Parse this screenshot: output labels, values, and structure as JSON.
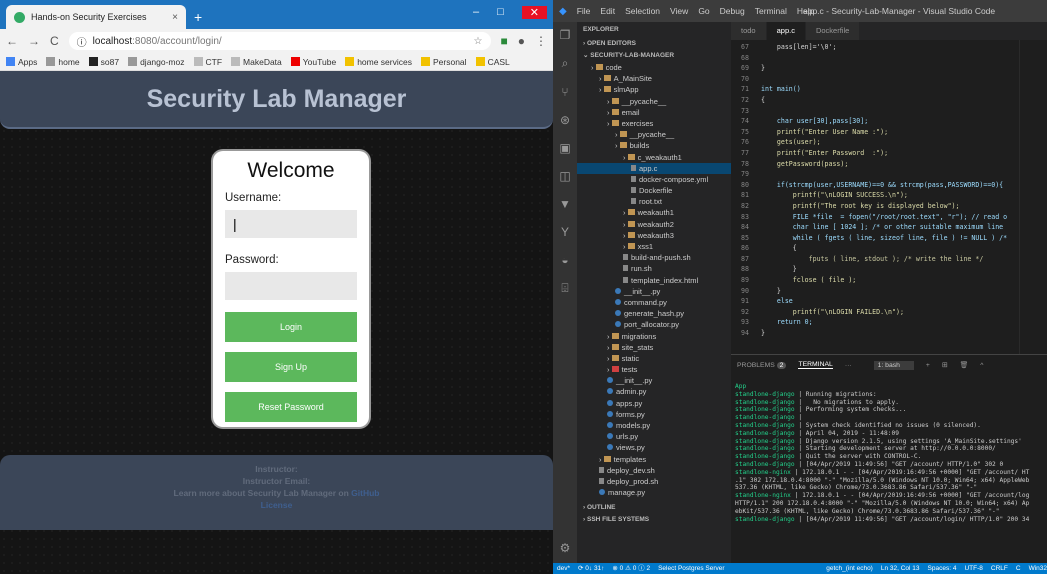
{
  "chrome": {
    "tab_title": "Hands-on Security Exercises",
    "tab_close": "×",
    "new_tab": "+",
    "win_min": "–",
    "win_max": "□",
    "win_close": "✕",
    "url_host": "localhost",
    "url_rest": ":8080/account/login/",
    "bookmarks": [
      {
        "label": "Apps",
        "icon": "apps-grid-icon"
      },
      {
        "label": "home",
        "icon": "bookmark-icon"
      },
      {
        "label": "so87",
        "icon": "github-icon"
      },
      {
        "label": "django-moz",
        "icon": "bookmark-icon"
      },
      {
        "label": "CTF",
        "icon": "page-icon"
      },
      {
        "label": "MakeData",
        "icon": "page-icon"
      },
      {
        "label": "YouTube",
        "icon": "youtube-icon"
      },
      {
        "label": "home services",
        "icon": "folder-icon"
      },
      {
        "label": "Personal",
        "icon": "folder-icon"
      },
      {
        "label": "CASL",
        "icon": "folder-icon"
      }
    ]
  },
  "site": {
    "header": "Security Lab Manager",
    "welcome": "Welcome",
    "username_label": "Username:",
    "password_label": "Password:",
    "login_btn": "Login",
    "signup_btn": "Sign Up",
    "reset_btn": "Reset Password",
    "footer_instructor": "Instructor:",
    "footer_email": "Instructor Email:",
    "footer_learn": "Learn more about Security Lab Manager on",
    "footer_link": "GitHub",
    "footer_license": "License"
  },
  "vscode": {
    "menu": [
      "File",
      "Edit",
      "Selection",
      "View",
      "Go",
      "Debug",
      "Terminal",
      "Help"
    ],
    "title": "app.c - Security-Lab-Manager - Visual Studio Code",
    "explorer_label": "EXPLORER",
    "open_editors": "OPEN EDITORS",
    "project": "SECURITY-LAB-MANAGER",
    "tree": [
      {
        "name": "code",
        "type": "folder",
        "depth": 1
      },
      {
        "name": "A_MainSite",
        "type": "folder",
        "depth": 2
      },
      {
        "name": "slmApp",
        "type": "folder",
        "depth": 2
      },
      {
        "name": "__pycache__",
        "type": "folder",
        "depth": 3
      },
      {
        "name": "email",
        "type": "folder",
        "depth": 3
      },
      {
        "name": "exercises",
        "type": "folder",
        "depth": 3
      },
      {
        "name": "__pycache__",
        "type": "folder",
        "depth": 4
      },
      {
        "name": "builds",
        "type": "folder",
        "depth": 4
      },
      {
        "name": "c_weakauth1",
        "type": "folder",
        "depth": 5
      },
      {
        "name": "app.c",
        "type": "file",
        "depth": 6
      },
      {
        "name": "docker-compose.yml",
        "type": "file",
        "depth": 6
      },
      {
        "name": "Dockerfile",
        "type": "file",
        "depth": 6
      },
      {
        "name": "root.txt",
        "type": "file",
        "depth": 6
      },
      {
        "name": "weakauth1",
        "type": "folder",
        "depth": 5
      },
      {
        "name": "weakauth2",
        "type": "folder",
        "depth": 5
      },
      {
        "name": "weakauth3",
        "type": "folder",
        "depth": 5
      },
      {
        "name": "xss1",
        "type": "folder",
        "depth": 5
      },
      {
        "name": "build-and-push.sh",
        "type": "file",
        "depth": 5
      },
      {
        "name": "run.sh",
        "type": "file",
        "depth": 5
      },
      {
        "name": "template_index.html",
        "type": "file",
        "depth": 5
      },
      {
        "name": "__init__.py",
        "type": "py",
        "depth": 4
      },
      {
        "name": "command.py",
        "type": "py",
        "depth": 4
      },
      {
        "name": "generate_hash.py",
        "type": "py",
        "depth": 4
      },
      {
        "name": "port_allocator.py",
        "type": "py",
        "depth": 4
      },
      {
        "name": "migrations",
        "type": "folder",
        "depth": 3
      },
      {
        "name": "site_stats",
        "type": "folder",
        "depth": 3
      },
      {
        "name": "static",
        "type": "folder",
        "depth": 3
      },
      {
        "name": "tests",
        "type": "red",
        "depth": 3
      },
      {
        "name": "__init__.py",
        "type": "py",
        "depth": 3
      },
      {
        "name": "admin.py",
        "type": "py",
        "depth": 3
      },
      {
        "name": "apps.py",
        "type": "py",
        "depth": 3
      },
      {
        "name": "forms.py",
        "type": "py",
        "depth": 3
      },
      {
        "name": "models.py",
        "type": "py",
        "depth": 3
      },
      {
        "name": "urls.py",
        "type": "py",
        "depth": 3
      },
      {
        "name": "views.py",
        "type": "py",
        "depth": 3
      },
      {
        "name": "templates",
        "type": "folder",
        "depth": 2
      },
      {
        "name": "deploy_dev.sh",
        "type": "file",
        "depth": 2
      },
      {
        "name": "deploy_prod.sh",
        "type": "file",
        "depth": 2
      },
      {
        "name": "manage.py",
        "type": "py",
        "depth": 2
      }
    ],
    "outline": "OUTLINE",
    "ssh": "SSH FILE SYSTEMS",
    "tabs": [
      "todo",
      "app.c",
      "Dockerfile"
    ],
    "code_lines": [
      {
        "n": "67",
        "t": "    pass[len]='\\0';"
      },
      {
        "n": "68",
        "t": ""
      },
      {
        "n": "69",
        "t": "}"
      },
      {
        "n": "70",
        "t": ""
      },
      {
        "n": "71",
        "t": "int main()"
      },
      {
        "n": "72",
        "t": "{"
      },
      {
        "n": "73",
        "t": ""
      },
      {
        "n": "74",
        "t": "    char user[30],pass[30];"
      },
      {
        "n": "75",
        "t": "    printf(\"Enter User Name :\");"
      },
      {
        "n": "76",
        "t": "    gets(user);"
      },
      {
        "n": "77",
        "t": "    printf(\"Enter Password  :\");"
      },
      {
        "n": "78",
        "t": "    getPassword(pass);"
      },
      {
        "n": "79",
        "t": ""
      },
      {
        "n": "80",
        "t": "    if(strcmp(user,USERNAME)==0 && strcmp(pass,PASSWORD)==0){"
      },
      {
        "n": "81",
        "t": "        printf(\"\\nLOGIN SUCCESS.\\n\");"
      },
      {
        "n": "82",
        "t": "        printf(\"The root key is displayed below\");"
      },
      {
        "n": "83",
        "t": "        FILE *file  = fopen(\"/root/root.text\", \"r\"); // read o"
      },
      {
        "n": "84",
        "t": "        char line [ 1024 ]; /* or other suitable maximum line"
      },
      {
        "n": "85",
        "t": "        while ( fgets ( line, sizeof line, file ) != NULL ) /*"
      },
      {
        "n": "86",
        "t": "        {"
      },
      {
        "n": "87",
        "t": "            fputs ( line, stdout ); /* write the line */"
      },
      {
        "n": "88",
        "t": "        }"
      },
      {
        "n": "89",
        "t": "        fclose ( file );"
      },
      {
        "n": "90",
        "t": "    }"
      },
      {
        "n": "91",
        "t": "    else"
      },
      {
        "n": "92",
        "t": "        printf(\"\\nLOGIN FAILED.\\n\");"
      },
      {
        "n": "93",
        "t": "    return 0;"
      },
      {
        "n": "94",
        "t": "}"
      }
    ],
    "panel": {
      "problems": "PROBLEMS",
      "problems_count": "2",
      "terminal": "TERMINAL",
      "more": "···",
      "shell": "1: bash"
    },
    "terminal_lines": [
      {
        "p": "App",
        "t": ""
      },
      {
        "p": "standlone-django",
        "t": " | Running migrations:"
      },
      {
        "p": "standlone-django",
        "t": " |   No migrations to apply."
      },
      {
        "p": "standlone-django",
        "t": " | Performing system checks..."
      },
      {
        "p": "standlone-django",
        "t": " |"
      },
      {
        "p": "standlone-django",
        "t": " | System check identified no issues (0 silenced)."
      },
      {
        "p": "standlone-django",
        "t": " | April 04, 2019 - 11:48:09"
      },
      {
        "p": "standlone-django",
        "t": " | Django version 2.1.5, using settings 'A_MainSite.settings'"
      },
      {
        "p": "standlone-django",
        "t": " | Starting development server at http://0.0.0.0:8000/"
      },
      {
        "p": "standlone-django",
        "t": " | Quit the server with CONTROL-C."
      },
      {
        "p": "standlone-django",
        "t": " | [04/Apr/2019 11:49:56] \"GET /account/ HTTP/1.0\" 302 0"
      },
      {
        "p": "standlone-nginx",
        "t": " | 172.18.0.1 - - [04/Apr/2019:16:49:56 +0000] \"GET /account/ HT"
      },
      {
        "p": "",
        "t": ".1\" 302 172.18.0.4:8000 \"-\" \"Mozilla/5.0 (Windows NT 10.0; Win64; x64) AppleWeb"
      },
      {
        "p": "",
        "t": "537.36 (KHTML, like Gecko) Chrome/73.0.3683.86 Safari/537.36\" \"-\""
      },
      {
        "p": "standlone-nginx",
        "t": " | 172.18.0.1 - - [04/Apr/2019:16:49:56 +0000] \"GET /account/log"
      },
      {
        "p": "",
        "t": "HTTP/1.1\" 200 172.18.0.4:8000 \"-\" \"Mozilla/5.0 (Windows NT 10.0; Win64; x64) Ap"
      },
      {
        "p": "",
        "t": "ebKit/537.36 (KHTML, like Gecko) Chrome/73.0.3683.86 Safari/537.36\" \"-\""
      },
      {
        "p": "standlone-django",
        "t": " | [04/Apr/2019 11:49:56] \"GET /account/login/ HTTP/1.0\" 200 34"
      }
    ],
    "status": {
      "branch": "dev*",
      "sync": "⟳ 0↓ 31↑",
      "errors": "⊗ 0 ⚠ 0 ⓘ 2",
      "postgres": "Select Postgres Server",
      "func": "getch_(int echo)",
      "pos": "Ln 32, Col 13",
      "spaces": "Spaces: 4",
      "enc": "UTF-8",
      "eol": "CRLF",
      "lang": "C",
      "platform": "Win32"
    }
  }
}
